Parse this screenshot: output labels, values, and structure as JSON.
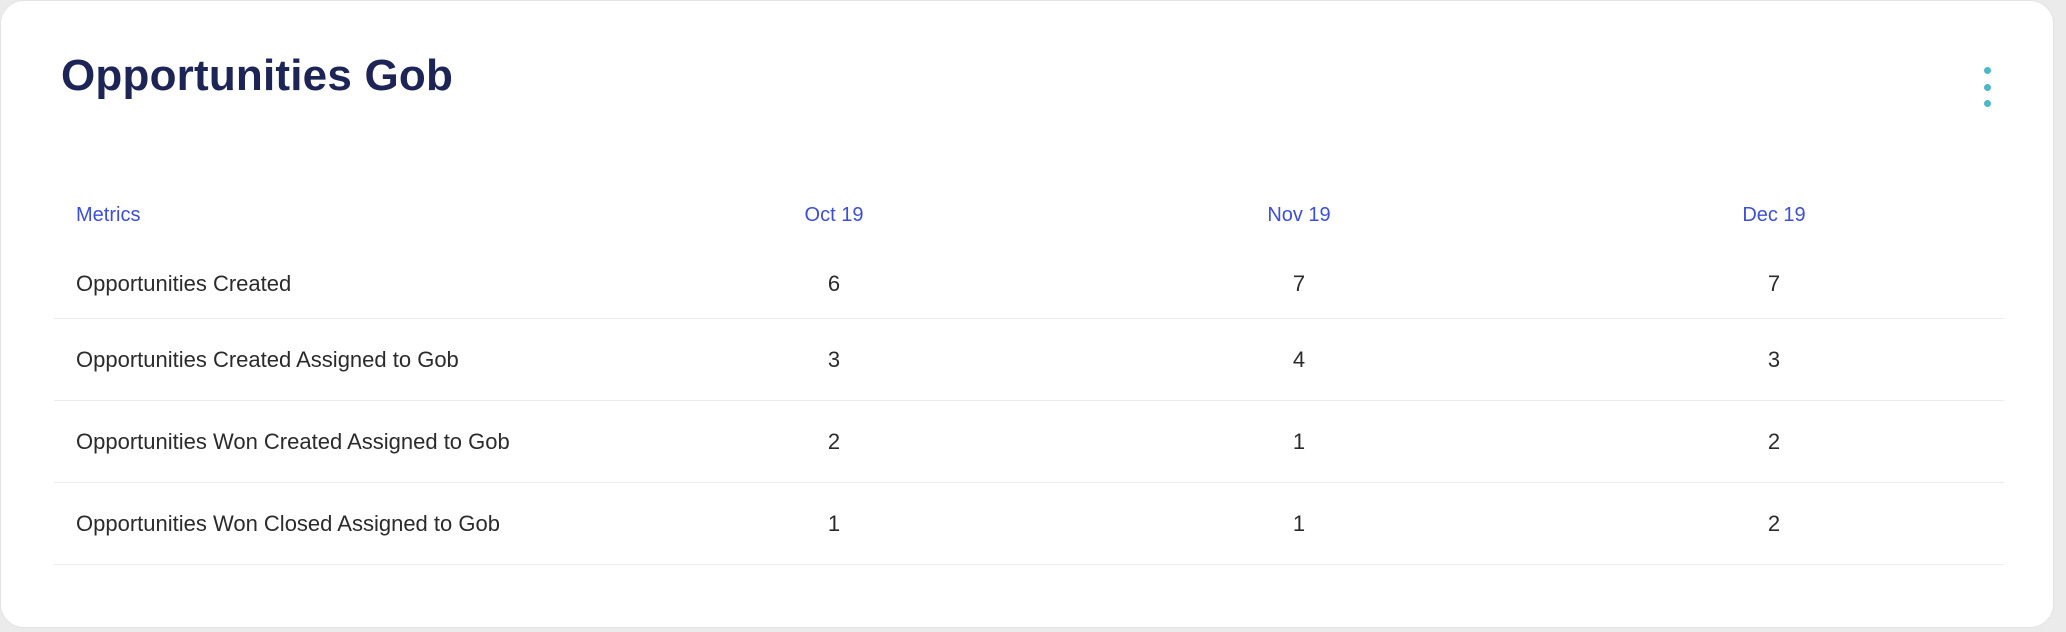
{
  "card": {
    "title": "Opportunities Gob"
  },
  "colors": {
    "title": "#1d2456",
    "header_text": "#3d4fd8",
    "menu_dots": "#4ab8c6",
    "body_text": "#2b2b2b"
  },
  "icons": {
    "menu": "more-vertical-icon"
  },
  "table": {
    "headers": [
      "Metrics",
      "Oct 19",
      "Nov 19",
      "Dec 19"
    ],
    "rows": [
      {
        "metric": "Opportunities Created",
        "values": [
          "6",
          "7",
          "7"
        ]
      },
      {
        "metric": "Opportunities Created Assigned to Gob",
        "values": [
          "3",
          "4",
          "3"
        ]
      },
      {
        "metric": "Opportunities Won Created Assigned to Gob",
        "values": [
          "2",
          "1",
          "2"
        ]
      },
      {
        "metric": "Opportunities Won Closed Assigned to Gob",
        "values": [
          "1",
          "1",
          "2"
        ]
      }
    ]
  }
}
